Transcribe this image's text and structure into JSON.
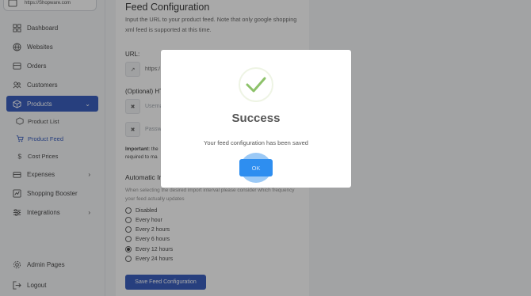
{
  "store": {
    "url": "https://Shopware.com"
  },
  "sidebar": {
    "items": [
      {
        "label": "Dashboard",
        "icon": "dashboard-icon"
      },
      {
        "label": "Websites",
        "icon": "globe-icon"
      },
      {
        "label": "Orders",
        "icon": "orders-icon"
      },
      {
        "label": "Customers",
        "icon": "users-icon"
      },
      {
        "label": "Products",
        "icon": "box-icon",
        "active": true
      },
      {
        "label": "Expenses",
        "icon": "expenses-icon"
      },
      {
        "label": "Shopping Booster",
        "icon": "booster-icon"
      },
      {
        "label": "Integrations",
        "icon": "integrations-icon"
      },
      {
        "label": "Admin Pages",
        "icon": "gear-icon"
      },
      {
        "label": "Logout",
        "icon": "logout-icon"
      }
    ],
    "sub_items": [
      {
        "label": "Product List"
      },
      {
        "label": "Product Feed",
        "active": true
      },
      {
        "label": "Cost Prices"
      }
    ]
  },
  "feed": {
    "title": "Feed Configuration",
    "description": "Input the URL to your product feed. Note that only google shopping xml feed is supported at this time.",
    "url_label": "URL:",
    "url_value": "https:/",
    "auth_label": "(Optional) HT",
    "username_placeholder": "Userna",
    "password_placeholder": "Passwo",
    "important_bold": "Important:",
    "important_text": " the",
    "important_line2": "required to ma",
    "import_title": "Automatic Im",
    "import_hint": "When selecting the desired import interval please consider which frequency your feed actually updates",
    "intervals": [
      {
        "label": "Disabled",
        "selected": false
      },
      {
        "label": "Every hour",
        "selected": false
      },
      {
        "label": "Every 2 hours",
        "selected": false
      },
      {
        "label": "Every 6 hours",
        "selected": false
      },
      {
        "label": "Every 12 hours",
        "selected": true
      },
      {
        "label": "Every 24 hours",
        "selected": false
      }
    ],
    "save_label": "Save Feed Configuration"
  },
  "modal": {
    "title": "Success",
    "message": "Your feed configuration has been saved",
    "ok_label": "OK",
    "icon": "check-icon"
  },
  "colors": {
    "primary": "#1f49b6",
    "ok_button": "#2e8ef0",
    "check": "#8dc26a"
  }
}
